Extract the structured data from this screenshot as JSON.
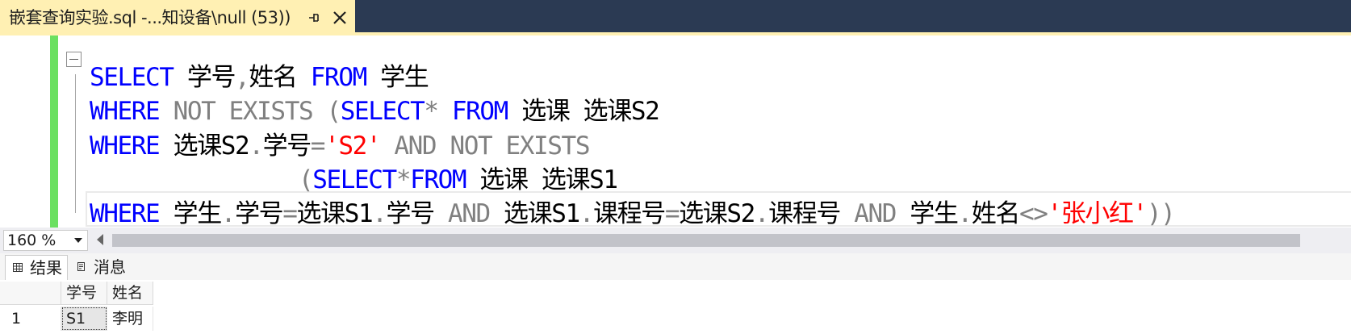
{
  "tab": {
    "title": "嵌套查询实验.sql -...知设备\\null (53))",
    "pin_icon": "pin-icon",
    "close_icon": "close-icon"
  },
  "editor": {
    "lines": [
      [
        {
          "t": "SELECT",
          "c": "kw"
        },
        {
          "t": " 学号",
          "c": "id"
        },
        {
          "t": ",",
          "c": "op"
        },
        {
          "t": "姓名 ",
          "c": "id"
        },
        {
          "t": "FROM",
          "c": "kw"
        },
        {
          "t": " 学生",
          "c": "id"
        }
      ],
      [
        {
          "t": "WHERE",
          "c": "kw"
        },
        {
          "t": " NOT EXISTS (",
          "c": "op"
        },
        {
          "t": "SELECT",
          "c": "kw"
        },
        {
          "t": "* ",
          "c": "op"
        },
        {
          "t": "FROM",
          "c": "kw"
        },
        {
          "t": " 选课 选课S2",
          "c": "id"
        }
      ],
      [
        {
          "t": "WHERE",
          "c": "kw"
        },
        {
          "t": " 选课S2",
          "c": "id"
        },
        {
          "t": ".",
          "c": "op"
        },
        {
          "t": "学号",
          "c": "id"
        },
        {
          "t": "=",
          "c": "op"
        },
        {
          "t": "'S2'",
          "c": "str"
        },
        {
          "t": " AND NOT EXISTS",
          "c": "op"
        }
      ],
      [
        {
          "t": "               (",
          "c": "op"
        },
        {
          "t": "SELECT",
          "c": "kw"
        },
        {
          "t": "*",
          "c": "op"
        },
        {
          "t": "FROM",
          "c": "kw"
        },
        {
          "t": " 选课 选课S1",
          "c": "id"
        }
      ],
      [
        {
          "t": "WHERE",
          "c": "kw"
        },
        {
          "t": " 学生",
          "c": "id"
        },
        {
          "t": ".",
          "c": "op"
        },
        {
          "t": "学号",
          "c": "id"
        },
        {
          "t": "=",
          "c": "op"
        },
        {
          "t": "选课S1",
          "c": "id"
        },
        {
          "t": ".",
          "c": "op"
        },
        {
          "t": "学号 ",
          "c": "id"
        },
        {
          "t": "AND",
          "c": "op"
        },
        {
          "t": " 选课S1",
          "c": "id"
        },
        {
          "t": ".",
          "c": "op"
        },
        {
          "t": "课程号",
          "c": "id"
        },
        {
          "t": "=",
          "c": "op"
        },
        {
          "t": "选课S2",
          "c": "id"
        },
        {
          "t": ".",
          "c": "op"
        },
        {
          "t": "课程号 ",
          "c": "id"
        },
        {
          "t": "AND",
          "c": "op"
        },
        {
          "t": " 学生",
          "c": "id"
        },
        {
          "t": ".",
          "c": "op"
        },
        {
          "t": "姓名",
          "c": "id"
        },
        {
          "t": "<>",
          "c": "op"
        },
        {
          "t": "'张小红'",
          "c": "str"
        },
        {
          "t": "))",
          "c": "op"
        }
      ]
    ]
  },
  "zoom": {
    "value": "160 %"
  },
  "results": {
    "tabs": [
      {
        "label": "结果",
        "icon": "grid-icon"
      },
      {
        "label": "消息",
        "icon": "message-icon"
      }
    ],
    "columns": [
      "学号",
      "姓名"
    ],
    "rows": [
      {
        "num": "1",
        "cells": [
          "S1",
          "李明"
        ]
      }
    ]
  },
  "colors": {
    "keyword": "#0000ff",
    "operator": "#808080",
    "string": "#ff0000",
    "tab_active": "#fff0b3",
    "change_bar": "#6be061",
    "chrome": "#2b3a53"
  }
}
